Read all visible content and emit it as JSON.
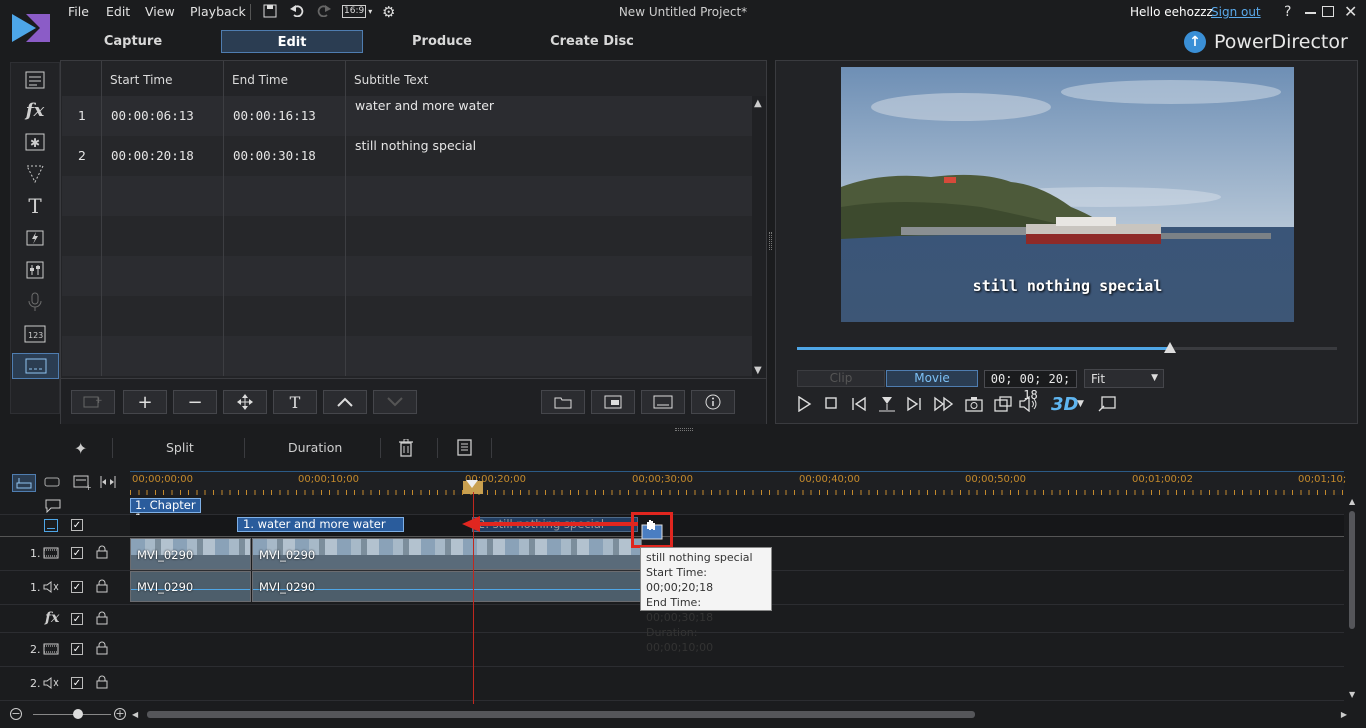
{
  "menu": {
    "file": "File",
    "edit": "Edit",
    "view": "View",
    "playback": "Playback",
    "aspect": "16:9"
  },
  "window": {
    "title": "New Untitled Project*",
    "greeting": "Hello eehozzz",
    "signout": "Sign out",
    "help": "?"
  },
  "tabs": {
    "capture": "Capture",
    "edit": "Edit",
    "produce": "Produce",
    "create_disc": "Create Disc"
  },
  "brand": "PowerDirector",
  "subtitle_table": {
    "headers": {
      "start": "Start Time",
      "end": "End Time",
      "text": "Subtitle Text"
    },
    "rows": [
      {
        "num": "1",
        "start": "00:00:06:13",
        "end": "00:00:16:13",
        "text": "water and more water"
      },
      {
        "num": "2",
        "start": "00:00:20:18",
        "end": "00:00:30:18",
        "text": "still nothing special"
      }
    ]
  },
  "preview": {
    "subtitle_overlay": "still nothing special",
    "clip": "Clip",
    "movie": "Movie",
    "timecode": "00; 00; 20; 18",
    "fit": "Fit",
    "scrub_progress": 0.69,
    "threed": "3D"
  },
  "timeline_toolbar": {
    "split": "Split",
    "duration": "Duration"
  },
  "ruler": [
    "00;00;00;00",
    "00;00;10;00",
    "00;00;20;00",
    "00;00;30;00",
    "00;00;40;00",
    "00;00;50;00",
    "00;01;00;02",
    "00;01;10;"
  ],
  "tracks": {
    "chapter": "1. Chapter 1",
    "subtitle_clips": [
      "1. water and more water",
      "2. still nothing special"
    ],
    "video1": "1.",
    "audio1": "1.",
    "video2": "2.",
    "audio2": "2.",
    "clip_names": [
      "MVI_0290",
      "MVI_0290",
      "MVI_0290",
      "MVI_0290"
    ]
  },
  "tooltip": {
    "title": "still nothing special",
    "start": "Start Time: 00;00;20;18",
    "end": "End Time: 00;00;30;18",
    "duration": "Duration: 00;00;10;00"
  },
  "colors": {
    "accent": "#4f9fe0",
    "highlight": "#e0261f",
    "tab_active": "#2b3d52"
  }
}
